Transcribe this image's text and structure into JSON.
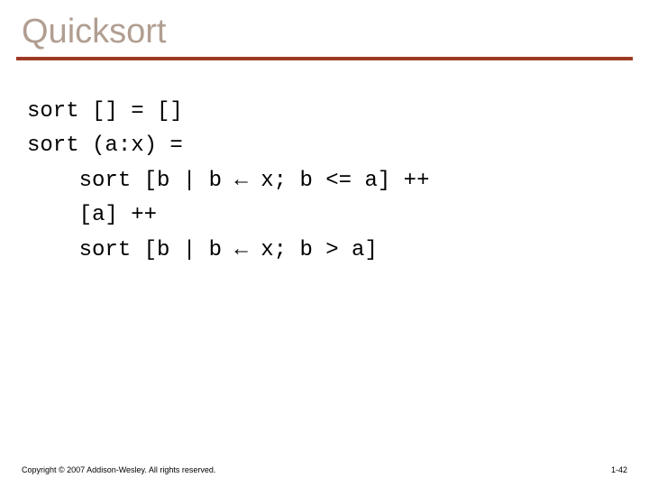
{
  "title": "Quicksort",
  "code": {
    "l1": "sort [] = []",
    "l2": "sort (a:x) =",
    "l3": "    sort [b | b ← x; b <= a] ++",
    "l4": "    [a] ++",
    "l5": "    sort [b | b ← x; b > a]"
  },
  "footer": {
    "copyright": "Copyright © 2007 Addison-Wesley. All rights reserved.",
    "page": "1-42"
  }
}
